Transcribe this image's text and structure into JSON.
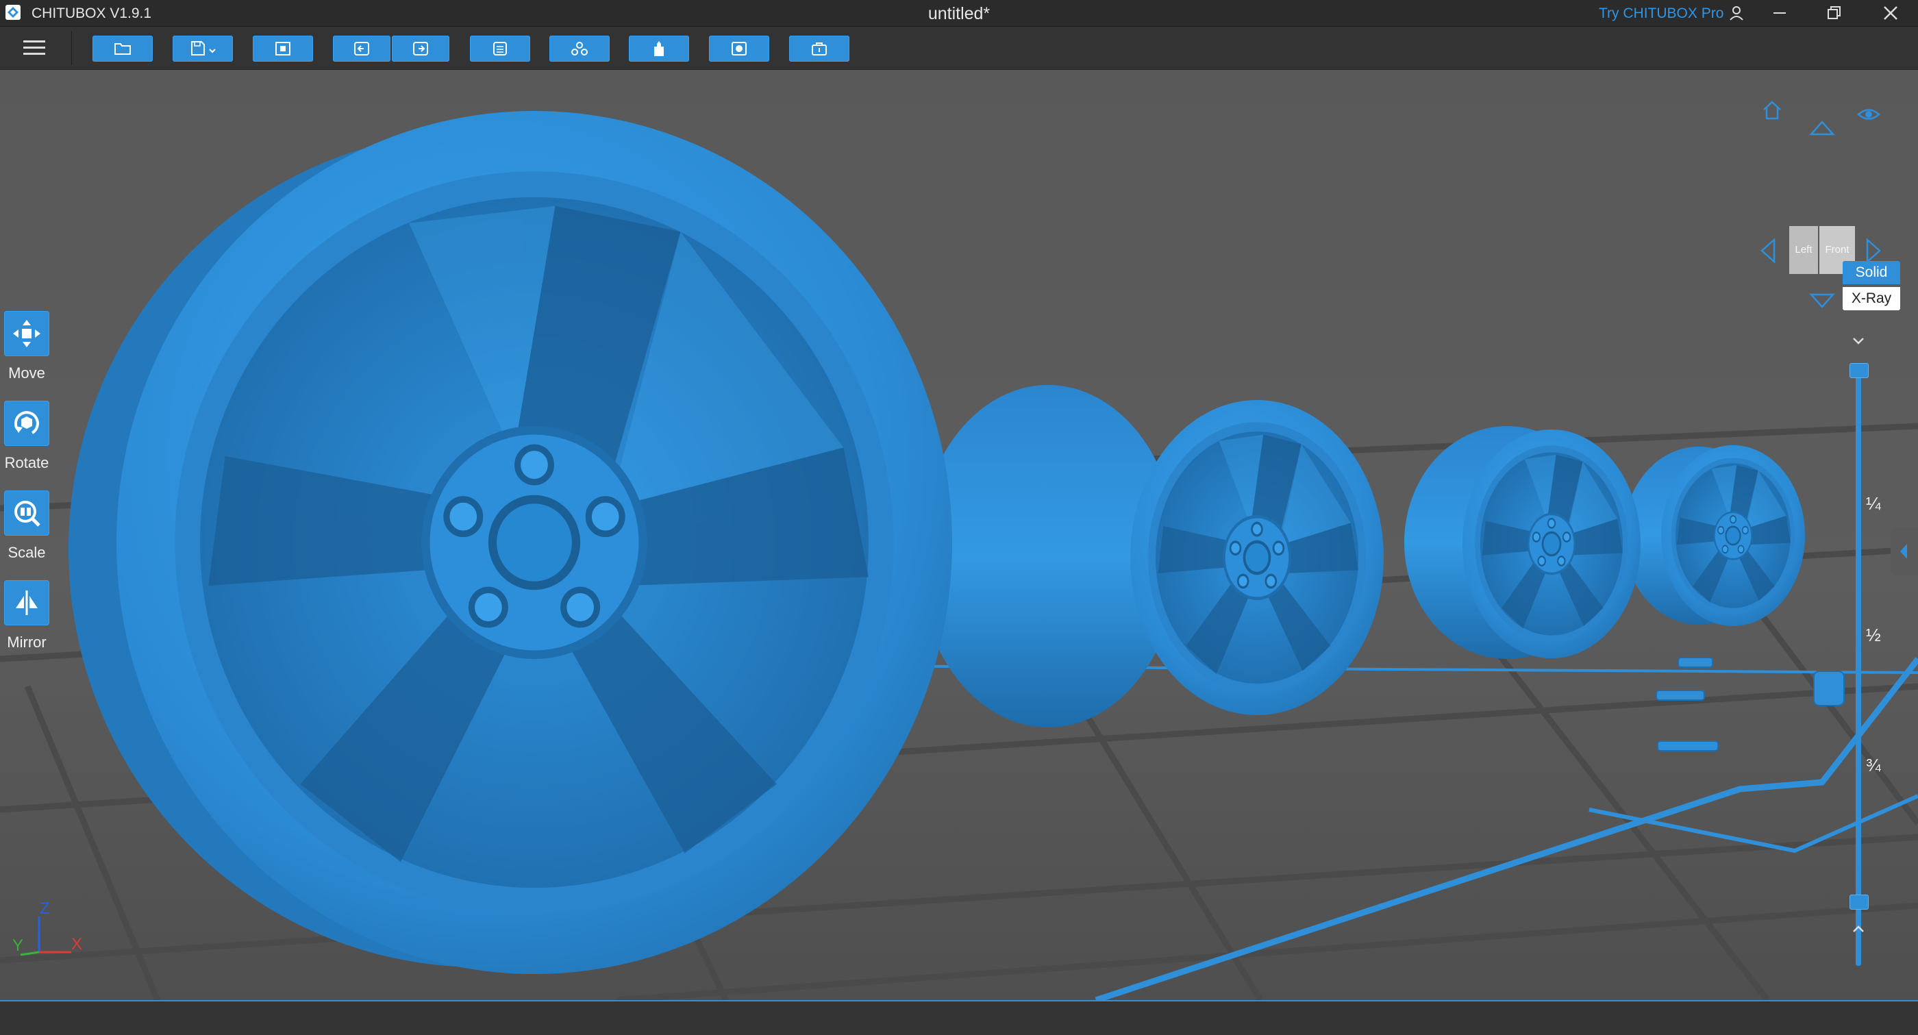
{
  "app": {
    "name": "CHITUBOX V1.9.1",
    "document_title": "untitled*",
    "try_pro": "Try CHITUBOX Pro"
  },
  "colors": {
    "accent": "#2f8fd8",
    "model": "#2f8fd8",
    "background": "#5a5a5a"
  },
  "window_controls": [
    "user-icon",
    "minimize-icon",
    "restore-icon",
    "close-icon"
  ],
  "toolbar": {
    "buttons": [
      "open-file-icon",
      "save-icon",
      "screenshot-icon",
      "undo-icon",
      "redo-icon",
      "slice-settings-icon",
      "support-icon",
      "hollow-icon",
      "layout-icon",
      "export-icon"
    ]
  },
  "tools": [
    {
      "label": "Move",
      "icon": "move-icon"
    },
    {
      "label": "Rotate",
      "icon": "rotate-icon"
    },
    {
      "label": "Scale",
      "icon": "scale-icon"
    },
    {
      "label": "Mirror",
      "icon": "mirror-icon"
    }
  ],
  "view_cube": {
    "left_label": "Left",
    "front_label": "Front"
  },
  "render_mode": {
    "solid": "Solid",
    "xray": "X-Ray",
    "selected": "Solid"
  },
  "layer_slider": {
    "ticks": [
      "¼",
      "½",
      "¾"
    ],
    "range": [
      0,
      1
    ]
  },
  "axes": {
    "x": "X",
    "y": "Y",
    "z": "Z"
  }
}
